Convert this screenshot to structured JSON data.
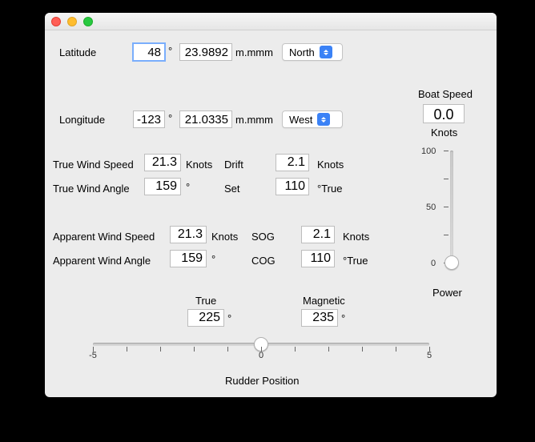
{
  "latitude": {
    "label": "Latitude",
    "deg": "48",
    "min": "23.9892",
    "deg_unit": "°",
    "min_unit": "m.mmm",
    "hemisphere": "North"
  },
  "longitude": {
    "label": "Longitude",
    "deg": "-123",
    "min": "21.0335",
    "deg_unit": "°",
    "min_unit": "m.mmm",
    "hemisphere": "West"
  },
  "boat_speed": {
    "label": "Boat Speed",
    "value": "0.0",
    "unit": "Knots"
  },
  "tws": {
    "label": "True Wind Speed",
    "value": "21.3",
    "unit": "Knots"
  },
  "twa": {
    "label": "True Wind Angle",
    "value": "159",
    "unit": "°"
  },
  "drift": {
    "label": "Drift",
    "value": "2.1",
    "unit": "Knots"
  },
  "set": {
    "label": "Set",
    "value": "110",
    "unit": "°True"
  },
  "aws": {
    "label": "Apparent Wind Speed",
    "value": "21.3",
    "unit": "Knots"
  },
  "awa": {
    "label": "Apparent Wind Angle",
    "value": "159",
    "unit": "°"
  },
  "sog": {
    "label": "SOG",
    "value": "2.1",
    "unit": "Knots"
  },
  "cog": {
    "label": "COG",
    "value": "110",
    "unit": "°True"
  },
  "heading": {
    "true_label": "True",
    "true_value": "225",
    "mag_label": "Magnetic",
    "mag_value": "235",
    "unit": "°"
  },
  "power": {
    "label": "Power",
    "min": 0,
    "max": 100,
    "value": 0,
    "ticks": [
      "100",
      "",
      "50",
      "",
      "0"
    ]
  },
  "rudder": {
    "label": "Rudder Position",
    "min": -5,
    "max": 5,
    "value": 0,
    "ticks": [
      "-5",
      "",
      "",
      "",
      "",
      "0",
      "",
      "",
      "",
      "",
      "5"
    ]
  }
}
